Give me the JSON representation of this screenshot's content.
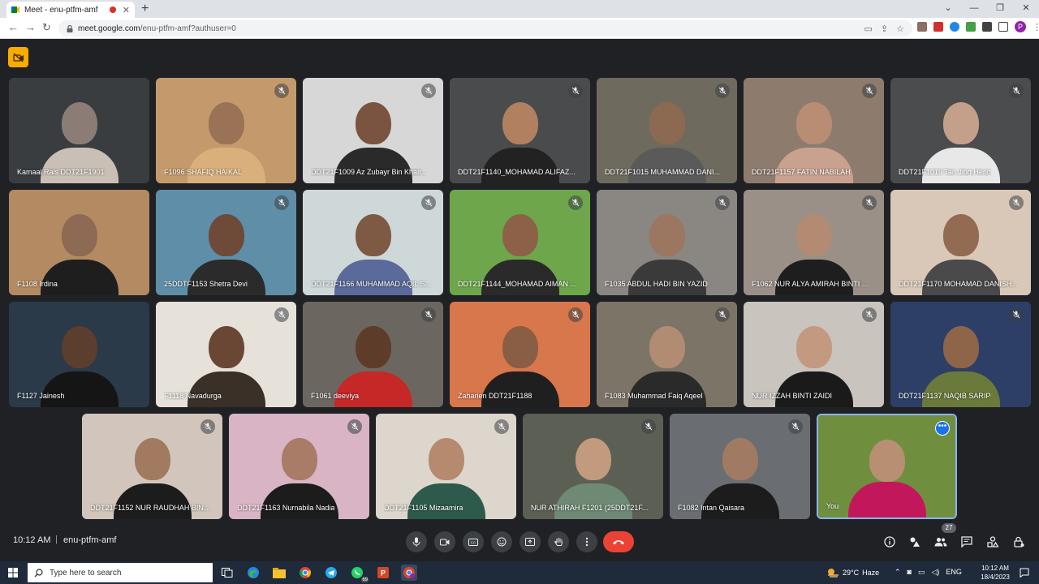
{
  "browser": {
    "tab_title": "Meet - enu-ptfm-amf",
    "url_host": "meet.google.com",
    "url_path": "/enu-ptfm-amf?authuser=0",
    "profile_initial": "P"
  },
  "meeting": {
    "time": "10:12 AM",
    "separator": "|",
    "code": "enu-ptfm-amf",
    "participant_count": "27"
  },
  "participants": [
    {
      "name": "Kamaal Rais DDT21F1901",
      "bg": "#3a3d40",
      "face": "#8b7d76",
      "body": "#c9bfb5",
      "muted": false
    },
    {
      "name": "F1096 SHAFIQ HAIKAL",
      "bg": "#c49a6c",
      "face": "#9a7256",
      "body": "#d9b07b",
      "muted": true
    },
    {
      "name": "DDT21F1009 Az Zubayr Bin Khair...",
      "bg": "#d7d7d7",
      "face": "#7a5440",
      "body": "#2a2a2a",
      "muted": true
    },
    {
      "name": "DDT21F1140_MOHAMAD ALIFAZ...",
      "bg": "#494b4d",
      "face": "#b08060",
      "body": "#222",
      "muted": true
    },
    {
      "name": "DDT21F1015 MUHAMMAD DANI...",
      "bg": "#6f6a5e",
      "face": "#8c6a52",
      "body": "#5a5a5a",
      "muted": true
    },
    {
      "name": "DDT21F1157 FATIN NABILAH",
      "bg": "#8d7c6e",
      "face": "#b88d74",
      "body": "#c9a28f",
      "muted": true
    },
    {
      "name": "DDT21F1019 Tan Jing Heng",
      "bg": "#4a4c4e",
      "face": "#c4a08a",
      "body": "#e8e8e8",
      "muted": true
    },
    {
      "name": "F1108 Irdina",
      "bg": "#b48a62",
      "face": "#8e6a55",
      "body": "#1e1e1e",
      "muted": false
    },
    {
      "name": "25DDTF1153 Shetra Devi",
      "bg": "#5f8fa8",
      "face": "#6e4a38",
      "body": "#2b2b2b",
      "muted": true
    },
    {
      "name": "DDT21F1166 MUHAMMAD AQIL S...",
      "bg": "#cfd8d8",
      "face": "#7e5a44",
      "body": "#5a6a9a",
      "muted": true
    },
    {
      "name": "DDT21F1144_MOHAMAD AIMAN ...",
      "bg": "#6ea64c",
      "face": "#8d6148",
      "body": "#2a2a2a",
      "muted": true
    },
    {
      "name": "F1035 ABDUL HADI BIN YAZID",
      "bg": "#8a8682",
      "face": "#9b7660",
      "body": "#3a3a3a",
      "muted": true
    },
    {
      "name": "F1062 NUR ALYA AMIRAH BINTI ...",
      "bg": "#9a9088",
      "face": "#b38b72",
      "body": "#1e1e1e",
      "muted": true
    },
    {
      "name": "DDT21F1170 MOHAMAD DANISH...",
      "bg": "#d9c8b8",
      "face": "#936a52",
      "body": "#4a4a4a",
      "muted": true
    },
    {
      "name": "F1127 Jainesh",
      "bg": "#2a3a48",
      "face": "#5c3e2e",
      "body": "#151515",
      "muted": false
    },
    {
      "name": "F1118 Navadurga",
      "bg": "#e6e2da",
      "face": "#6a4634",
      "body": "#3a3028",
      "muted": true
    },
    {
      "name": "F1061 deeviya",
      "bg": "#6b6760",
      "face": "#5e3c2a",
      "body": "#c62828",
      "muted": true
    },
    {
      "name": "Zaharien DDT21F1188",
      "bg": "#d8764c",
      "face": "#8a5e44",
      "body": "#1f1f1f",
      "muted": true
    },
    {
      "name": "F1083 Muhammad Faiq Aqeel",
      "bg": "#7d7468",
      "face": "#b18c73",
      "body": "#2a2a2a",
      "muted": true
    },
    {
      "name": "NUR IZZAH BINTI ZAIDI",
      "bg": "#c9c4be",
      "face": "#c39a80",
      "body": "#1a1a1a",
      "muted": true
    },
    {
      "name": "DDT21F1137 NAQIB SARIP",
      "bg": "#2d3f66",
      "face": "#8e6549",
      "body": "#6a7a3a",
      "muted": true
    },
    {
      "name": "DDT21F1152 NUR RAUDHAH BINT...",
      "bg": "#d2c6bc",
      "face": "#a27a60",
      "body": "#1c1c1c",
      "muted": true
    },
    {
      "name": "DDT21F1163 Nurnabila Nadia",
      "bg": "#d8b4c4",
      "face": "#a87c66",
      "body": "#1c1c1c",
      "muted": true
    },
    {
      "name": "DDT21F1105 Mizaamira",
      "bg": "#dcd6cc",
      "face": "#b68a6e",
      "body": "#2e5a4c",
      "muted": true
    },
    {
      "name": "NUR ATHIRAH F1201 (25DDT21F...",
      "bg": "#5c5f54",
      "face": "#c29a7e",
      "body": "#6e8a74",
      "muted": true
    },
    {
      "name": "F1082 Intan Qaisara",
      "bg": "#6a6e72",
      "face": "#a07a62",
      "body": "#1c1c1c",
      "muted": true
    }
  ],
  "self_tile": {
    "name": "You",
    "bg": "#6f8f3e",
    "face": "#b98f74",
    "body": "#c2185b"
  },
  "taskbar": {
    "search_placeholder": "Type here to search",
    "whatsapp_badge": "69",
    "temperature": "29°C",
    "weather": "Haze",
    "language": "ENG",
    "time": "10:12 AM",
    "date": "18/4/2023"
  }
}
